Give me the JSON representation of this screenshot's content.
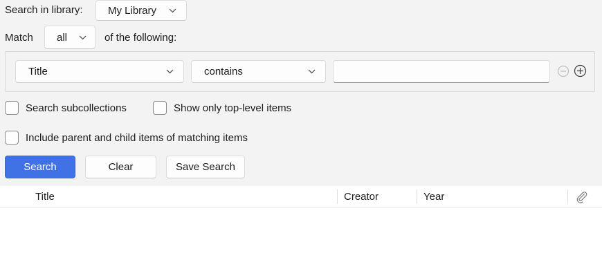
{
  "search_in": {
    "label": "Search in library:",
    "value": "My Library"
  },
  "match": {
    "label": "Match",
    "value": "all",
    "suffix": "of the following:"
  },
  "condition": {
    "field": "Title",
    "operator": "contains",
    "value": ""
  },
  "options": {
    "search_subcollections": {
      "label": "Search subcollections",
      "checked": false
    },
    "top_level_only": {
      "label": "Show only top-level items",
      "checked": false
    },
    "include_parent_child": {
      "label": "Include parent and child items of matching items",
      "checked": false
    }
  },
  "buttons": {
    "search": "Search",
    "clear": "Clear",
    "save_search": "Save Search"
  },
  "results": {
    "columns": [
      "Title",
      "Creator",
      "Year"
    ],
    "attachment_icon": "paperclip-icon"
  },
  "colors": {
    "accent": "#4072e5",
    "panel": "#f3f3f3"
  }
}
